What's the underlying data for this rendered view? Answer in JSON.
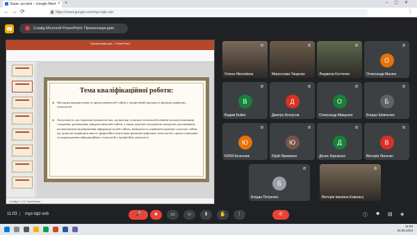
{
  "browser": {
    "tab_title": "Запис зустрічі – Google Meet",
    "url": "https://meet.google.com/myz-tqtz-xvb",
    "new_tab_glyph": "+",
    "window_controls": "–▢✕"
  },
  "meet": {
    "presenting_label": "Слайд Microsoft PowerPoint: Презентація.pptx",
    "meeting_code": "myz-tqtz-xvb",
    "time": "11:03"
  },
  "powerpoint": {
    "window_title": "Презентація.pptx – PowerPoint",
    "status_bar": "Слайд 2 з 12   Українська",
    "slide_title": "Тема кваліфікаційної роботи:",
    "bullet_1": "Методика використання та проектування веб-сайтів у професійній діяльності фахівця графічних технологій.",
    "bullet_2": "Актуальність дослідження зумовлена тим, що фахівці сучасних технологій повинні володіти вміннями створення, розміщення, використання веб-сайтів, а також доцільно поєднувати матеріали для навчання, налаштовувати відображення інформації на веб-сайтах, визначати та оцінювати критерії сучасних сайтів, що дозволяє підвищити якість професійної підготовки фахівців графічних технологій у процесі навчання та впровадження інформаційних технологій у професійну діяльність."
  },
  "participants": [
    {
      "name": "Олена Ніколаївна",
      "type": "video",
      "speaking": true
    },
    {
      "name": "Мирослава Тищенко",
      "type": "video"
    },
    {
      "name": "Людмила Костенко",
      "type": "video"
    },
    {
      "name": "Олександр Малюк",
      "type": "avatar",
      "initial": "О",
      "color": "#e8710a"
    },
    {
      "name": "Вадим Бойко",
      "type": "avatar",
      "initial": "В",
      "color": "#188038"
    },
    {
      "name": "Дмитро Білоусов",
      "type": "avatar",
      "initial": "Д",
      "color": "#d93025"
    },
    {
      "name": "Олександр Мищенко",
      "type": "avatar",
      "initial": "О",
      "color": "#188038"
    },
    {
      "name": "Богдан Шевченко",
      "type": "avatar",
      "initial": "Б",
      "color": "#5f6368"
    },
    {
      "name": "ЮЛІЯ Колесник",
      "type": "avatar",
      "initial": "Ю",
      "color": "#e8710a"
    },
    {
      "name": "Юрій Яременко",
      "type": "avatar",
      "initial": "Ю",
      "color": "#795548"
    },
    {
      "name": "Денис Корнієнко",
      "type": "avatar",
      "initial": "Д",
      "color": "#188038"
    },
    {
      "name": "Вікторія Лисенко",
      "type": "avatar",
      "initial": "В",
      "color": "#d93025"
    },
    {
      "name": "Богдан Петренко",
      "type": "avatar",
      "initial": "Б",
      "color": "#9aa0a6"
    },
    {
      "name": "Вікторія Іванівна Ковальчук",
      "type": "video"
    }
  ],
  "controls": {
    "mic": "mic-off-icon",
    "camera": "camera-off-icon",
    "captions": "captions-icon",
    "emoji": "emoji-icon",
    "present": "present-icon",
    "raise_hand": "hand-icon",
    "more": "more-icon",
    "leave": "leave-call-icon",
    "mute_glyph": "🎤",
    "more_glyph": "⋮",
    "leave_glyph": "✆"
  },
  "taskbar": {
    "time": "11:03",
    "date": "20.06.2023"
  },
  "colors": {
    "meet_bg": "#202124",
    "tile_bg": "#3c4043",
    "leave_red": "#ea4335",
    "ppt_red": "#b7472a"
  }
}
